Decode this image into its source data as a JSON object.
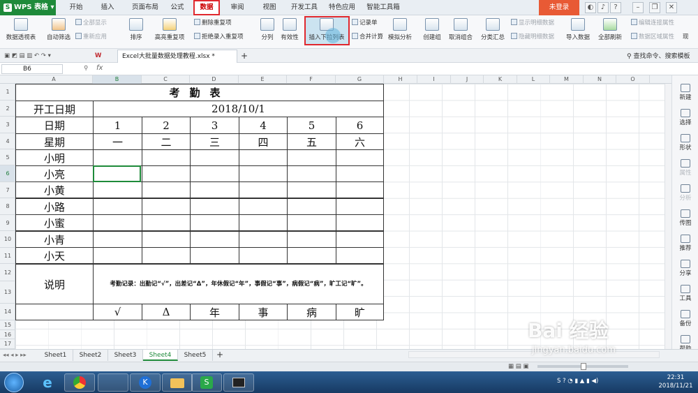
{
  "app": {
    "name": "WPS 表格",
    "login": "未登录"
  },
  "menu": [
    "开始",
    "插入",
    "页面布局",
    "公式",
    "数据",
    "审阅",
    "视图",
    "开发工具",
    "特色应用",
    "智能工具箱"
  ],
  "active_menu": "数据",
  "ribbon": {
    "pivot": "数据透视表",
    "autofilter": "自动筛选",
    "show_all": "全部显示",
    "reapply": "重新应用",
    "sort": "排序",
    "highlight_dup": "高亮重复项",
    "delete_dup": "删除重复项",
    "reject_dup": "拒绝录入重复项",
    "split": "分列",
    "validity": "有效性",
    "insert_dropdown": "插入下拉列表",
    "record_form": "记录单",
    "merge_calc": "合并计算",
    "simulate": "模拟分析",
    "create_group": "创建组",
    "ungroup": "取消组合",
    "subtotal": "分类汇总",
    "show_detail": "显示明细数据",
    "hide_detail": "隐藏明细数据",
    "import": "导入数据",
    "refresh_all": "全部刷新",
    "edit_links": "编辑连接属性",
    "data_range": "数据区域属性",
    "more": "现"
  },
  "doc_tab": "Excel大批量数据处理教程.xlsx *",
  "search_cmd": "查找命令、搜索模板",
  "name_box": "B6",
  "fx_label": "fx",
  "columns": [
    "A",
    "B",
    "C",
    "D",
    "E",
    "F",
    "G",
    "H",
    "I",
    "J",
    "K",
    "L",
    "M",
    "N",
    "O"
  ],
  "rows": [
    "1",
    "2",
    "3",
    "4",
    "5",
    "6",
    "7",
    "8",
    "9",
    "10",
    "11",
    "12",
    "13",
    "14",
    "15",
    "16",
    "17"
  ],
  "sheet": {
    "title": "考勤表",
    "start_label": "开工日期",
    "start_date": "2018/10/1",
    "date_label": "日期",
    "days": [
      "1",
      "2",
      "3",
      "4",
      "5",
      "6"
    ],
    "week_label": "星期",
    "weekdays": [
      "一",
      "二",
      "三",
      "四",
      "五",
      "六"
    ],
    "names": [
      "小明",
      "小亮",
      "小黄",
      "小路",
      "小蜜",
      "小青",
      "小天"
    ],
    "note_label": "说明",
    "note_text": "考勤记录：出勤记“√”，出差记“Δ”，年休假记“年”，事假记“事”，病假记“病”，旷工记“旷”。",
    "symbols": [
      "√",
      "Δ",
      "年",
      "事",
      "病",
      "旷"
    ]
  },
  "sheet_tabs": [
    "Sheet1",
    "Sheet2",
    "Sheet3",
    "Sheet4",
    "Sheet5"
  ],
  "active_sheet": "Sheet4",
  "right_panel": [
    "新建",
    "选择",
    "形状",
    "属性",
    "分析",
    "传图",
    "推荐",
    "分享",
    "工具",
    "备份",
    "帮助"
  ],
  "clock": {
    "time": "22:31",
    "date": "2018/11/21"
  },
  "watermark": {
    "brand": "Bai 经验",
    "url": "jingyan.baidu.com"
  }
}
